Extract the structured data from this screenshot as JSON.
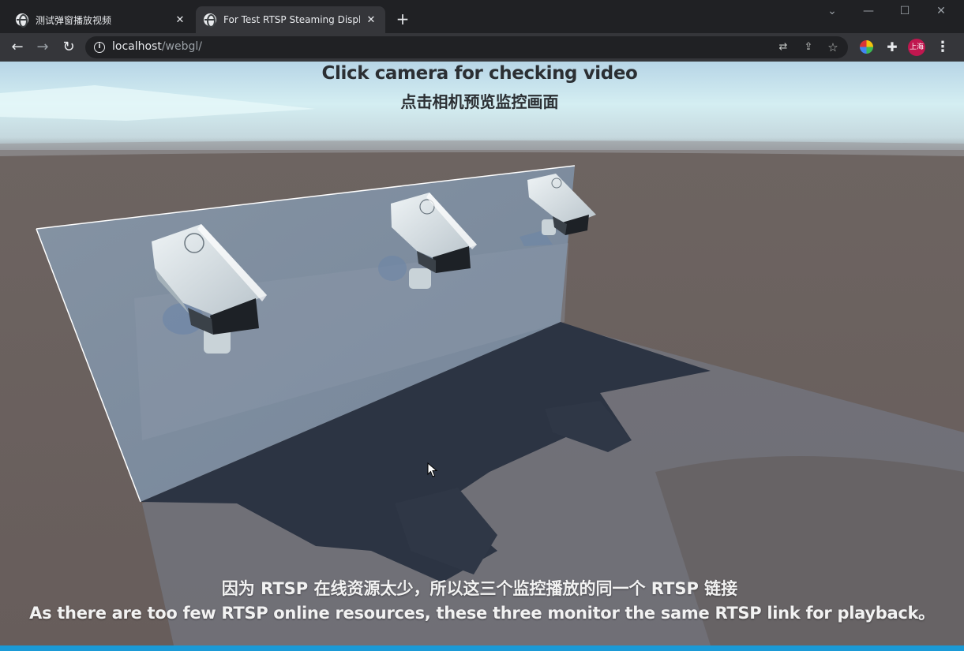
{
  "browser": {
    "tabs": [
      {
        "title": "测试弹窗播放视频",
        "active": false
      },
      {
        "title": "For Test RTSP Steaming Display",
        "active": true
      }
    ],
    "new_tab_label": "+",
    "address": {
      "host": "localhost",
      "path": "/webgl/"
    },
    "profile_label": "上海"
  },
  "page": {
    "instruction_en": "Click  camera for checking video",
    "instruction_zh": "点击相机预览监控画面",
    "note_zh": "因为 RTSP 在线资源太少，所以这三个监控播放的同一个 RTSP 链接",
    "note_en": "As there are too few RTSP online resources, these three monitor the same RTSP link for playback。"
  },
  "colors": {
    "accent": "#1a9ad6",
    "tabstrip": "#202124",
    "toolbar": "#35363a",
    "sky": "#c8e4ee",
    "ground": "#6b615f",
    "wall": "#7d8a9c",
    "shadow": "#2c3443"
  },
  "icons": [
    "globe-icon",
    "close-icon",
    "back-arrow-icon",
    "forward-arrow-icon",
    "reload-icon",
    "info-icon",
    "translate-icon",
    "share-icon",
    "star-icon",
    "extension-icon",
    "puzzle-icon",
    "menu-icon",
    "mouse-cursor-icon"
  ]
}
